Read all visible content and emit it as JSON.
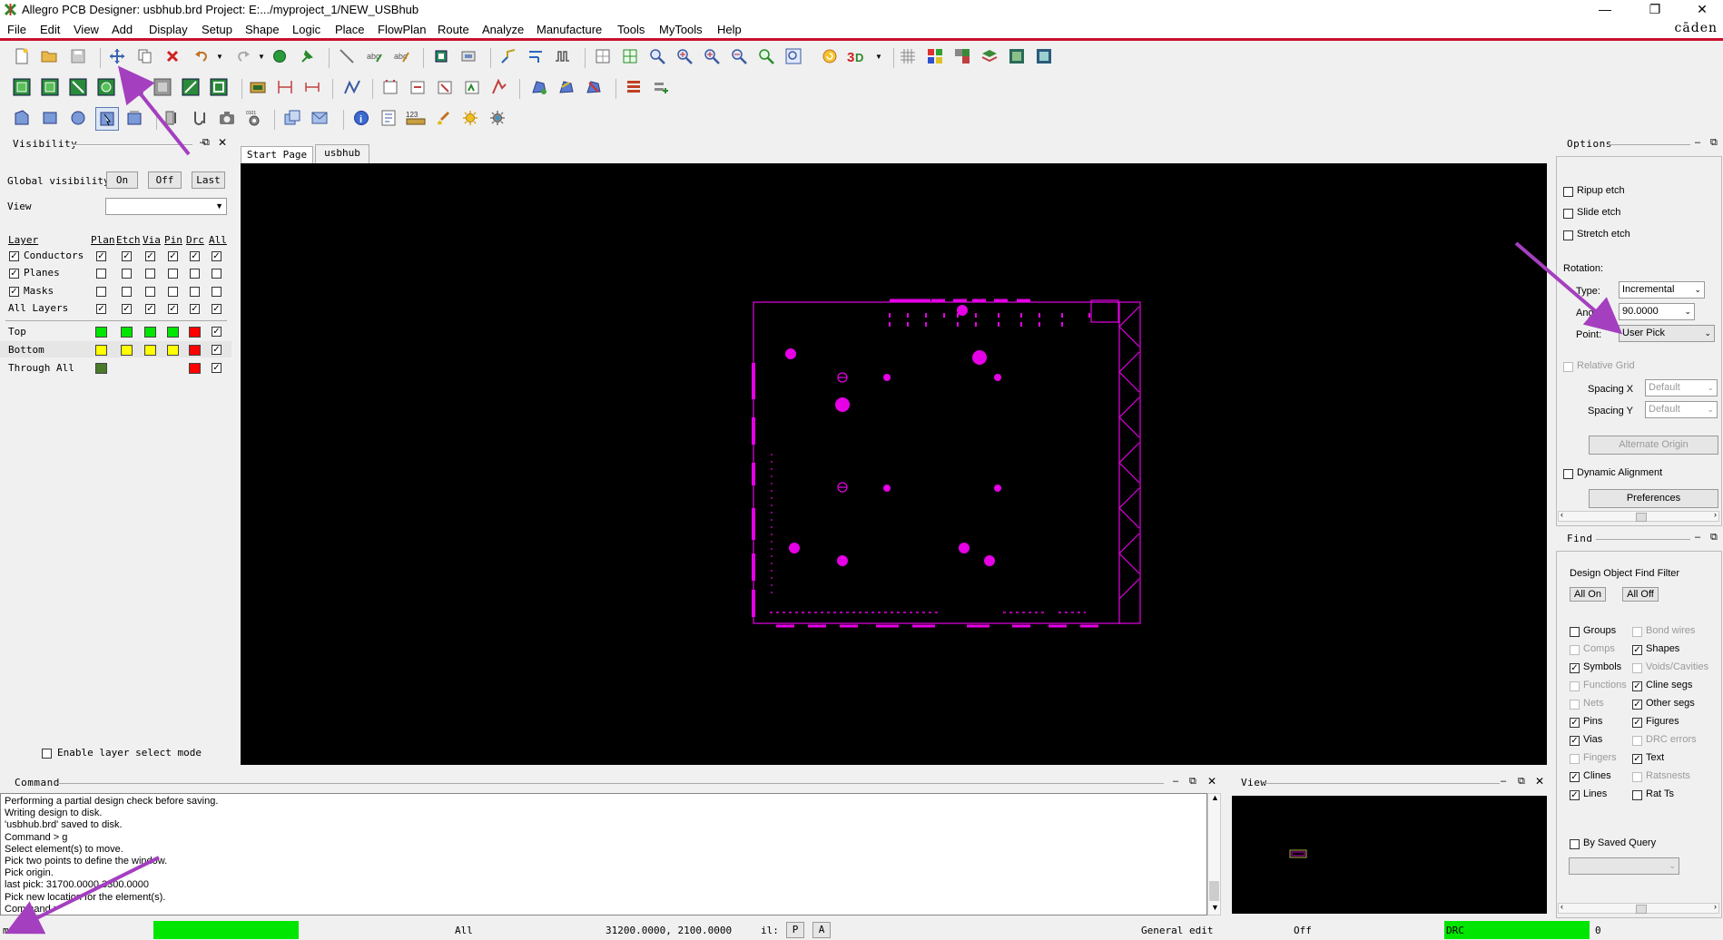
{
  "window": {
    "title": "Allegro PCB Designer: usbhub.brd  Project: E:.../myproject_1/NEW_USBhub",
    "brand": "cāden",
    "controls": [
      "—",
      "❐",
      "✕"
    ]
  },
  "menu": [
    "File",
    "Edit",
    "View",
    "Add",
    "Display",
    "Setup",
    "Shape",
    "Logic",
    "Place",
    "FlowPlan",
    "Route",
    "Analyze",
    "Manufacture",
    "Tools",
    "MyTools",
    "Help"
  ],
  "visibility": {
    "title": "Visibility",
    "global_label": "Global visibility",
    "on": "On",
    "off": "Off",
    "last": "Last",
    "view_label": "View",
    "view_value": "",
    "headers": [
      "Layer",
      "Plan",
      "Etch",
      "Via",
      "Pin",
      "Drc",
      "All"
    ],
    "rows": [
      {
        "label": "Conductors",
        "checked": true
      },
      {
        "label": "Planes",
        "checked": true
      },
      {
        "label": "Masks",
        "checked": true
      },
      {
        "label": "All Layers",
        "checked": false
      }
    ],
    "layers": [
      {
        "label": "Top"
      },
      {
        "label": "Bottom"
      },
      {
        "label": "Through All"
      }
    ],
    "colors": {
      "green": "#00e600",
      "yellow": "#ffff00",
      "red": "#ff0000",
      "dkgreen": "#4a7a2a"
    },
    "enable_layer_select": "Enable layer select mode"
  },
  "tabs": [
    "Start Page",
    "usbhub"
  ],
  "options": {
    "title": "Options",
    "ripup": "Ripup etch",
    "slide": "Slide etch",
    "stretch": "Stretch etch",
    "rotation": "Rotation:",
    "type_label": "Type:",
    "type_value": "Incremental",
    "angle_label": "Angle:",
    "angle_value": "90.0000",
    "point_label": "Point:",
    "point_value": "User Pick",
    "relative_grid": "Relative Grid",
    "spacing_x": "Spacing X",
    "spacing_y": "Spacing Y",
    "default": "Default",
    "alt_origin": "Alternate Origin",
    "dynamic_alignment": "Dynamic Alignment",
    "preferences": "Preferences"
  },
  "find": {
    "title": "Find",
    "filter_title": "Design Object Find Filter",
    "all_on": "All On",
    "all_off": "All Off",
    "left": [
      {
        "label": "Groups",
        "checked": false,
        "enabled": true
      },
      {
        "label": "Comps",
        "checked": false,
        "enabled": false
      },
      {
        "label": "Symbols",
        "checked": true,
        "enabled": true
      },
      {
        "label": "Functions",
        "checked": false,
        "enabled": false
      },
      {
        "label": "Nets",
        "checked": false,
        "enabled": false
      },
      {
        "label": "Pins",
        "checked": true,
        "enabled": true
      },
      {
        "label": "Vias",
        "checked": true,
        "enabled": true
      },
      {
        "label": "Fingers",
        "checked": false,
        "enabled": false
      },
      {
        "label": "Clines",
        "checked": true,
        "enabled": true
      },
      {
        "label": "Lines",
        "checked": true,
        "enabled": true
      }
    ],
    "right": [
      {
        "label": "Bond wires",
        "checked": false,
        "enabled": false
      },
      {
        "label": "Shapes",
        "checked": true,
        "enabled": true
      },
      {
        "label": "Voids/Cavities",
        "checked": false,
        "enabled": false
      },
      {
        "label": "Cline segs",
        "checked": true,
        "enabled": true
      },
      {
        "label": "Other segs",
        "checked": true,
        "enabled": true
      },
      {
        "label": "Figures",
        "checked": true,
        "enabled": true
      },
      {
        "label": "DRC errors",
        "checked": false,
        "enabled": false
      },
      {
        "label": "Text",
        "checked": true,
        "enabled": true
      },
      {
        "label": "Ratsnests",
        "checked": false,
        "enabled": false
      },
      {
        "label": "Rat Ts",
        "checked": false,
        "enabled": true
      }
    ],
    "by_saved_query": "By Saved Query"
  },
  "command": {
    "title": "Command",
    "lines": [
      "Performing a partial design check before saving.",
      "Writing design to disk.",
      "'usbhub.brd' saved to disk.",
      "Command > g",
      "Select element(s) to move.",
      "Pick two points to define the window.",
      "Pick origin.",
      "last pick:  31700.0000 3300.0000",
      "Pick new location for the element(s).",
      "Command >"
    ]
  },
  "view_panel": {
    "title": "View"
  },
  "status": {
    "mode": "move",
    "all": "All",
    "coords": "31200.0000, 2100.0000",
    "il": "il:",
    "p": "P",
    "a": "A",
    "edit": "General edit",
    "off": "Off",
    "drc": "DRC",
    "count": "0"
  },
  "colors": {
    "accent_red": "#c8102e",
    "board_magenta": "#e600e6",
    "arrow_purple": "#a43fbf"
  }
}
